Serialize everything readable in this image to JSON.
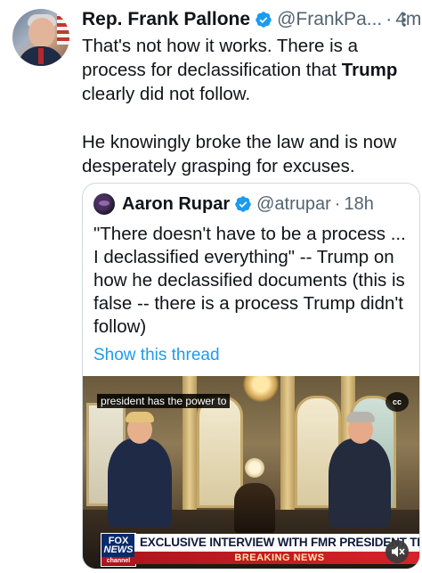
{
  "tweet": {
    "author_name": "Rep. Frank Pallone",
    "handle": "@FrankPa...",
    "separator": "·",
    "time": "4m",
    "text_line_1": "That's not how it works. There is a process for declassification that ",
    "text_bold": "Trump",
    "text_line_1_end": " clearly did not follow.",
    "text_para_2": "He knowingly broke the law and is now desperately grasping for excuses."
  },
  "quote": {
    "author_name": "Aaron Rupar",
    "handle": "@atrupar",
    "separator": "·",
    "time": "18h",
    "text": "\"There doesn't have to be a process ... I declassified everything\" -- Trump on how he declassified documents (this is false -- there is a process Trump didn't follow)",
    "show_thread": "Show this thread"
  },
  "video": {
    "caption": "president has the power to",
    "cc_label": "cc",
    "logo_line_1": "FOX",
    "logo_line_2": "NEWS",
    "logo_line_3": "channel",
    "banner": "EXCLUSIVE INTERVIEW WITH FMR PRESIDENT TRUMP",
    "breaking": "BREAKING NEWS"
  },
  "colors": {
    "link": "#1d9bf0",
    "verified": "#1d9bf0",
    "secondary_text": "#536471",
    "border": "#cfd9de"
  }
}
